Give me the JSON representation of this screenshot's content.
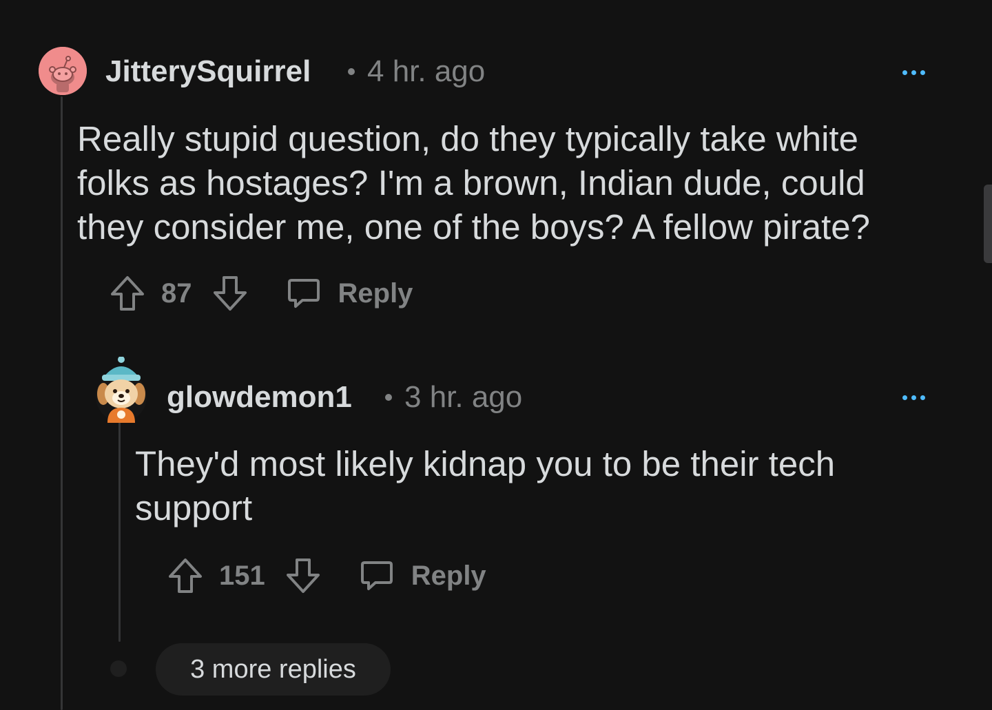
{
  "comments": [
    {
      "author": "JitterySquirrel",
      "time": "4 hr. ago",
      "body": "Really stupid question, do they typically take white folks as hostages? I'm a brown, Indian dude, could they consider me, one of the boys? A fellow pirate?",
      "score": "87",
      "reply_label": "Reply",
      "avatar": "snoo-pink-avatar"
    },
    {
      "author": "glowdemon1",
      "time": "3 hr. ago",
      "body": "They'd most likely kidnap you to be their tech support",
      "score": "151",
      "reply_label": "Reply",
      "avatar": "puppy-beanie-avatar"
    }
  ],
  "more_replies_label": "3 more replies",
  "colors": {
    "background": "#121212",
    "text": "#d7dadc",
    "muted": "#818384",
    "accent": "#4fbcff",
    "thread_line": "#343536",
    "pill": "#1f1f1f"
  },
  "icons": [
    "upvote-icon",
    "downvote-icon",
    "reply-bubble-icon",
    "more-options-icon"
  ]
}
